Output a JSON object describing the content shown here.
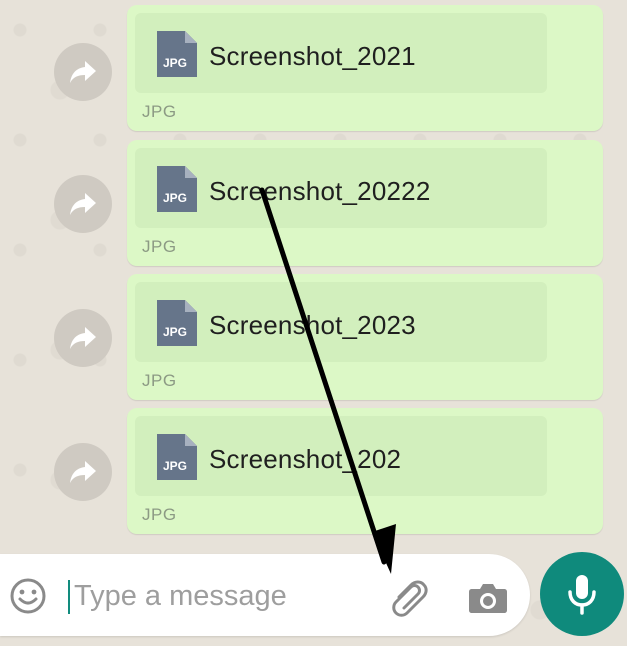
{
  "messages": [
    {
      "file_name": "Screenshot_2021",
      "file_type": "JPG",
      "icon_label": "JPG"
    },
    {
      "file_name": "Screenshot_20222",
      "file_type": "JPG",
      "icon_label": "JPG"
    },
    {
      "file_name": "Screenshot_2023",
      "file_type": "JPG",
      "icon_label": "JPG"
    },
    {
      "file_name": "Screenshot_202",
      "file_type": "JPG",
      "icon_label": "JPG"
    }
  ],
  "composer": {
    "placeholder": "Type a message",
    "value": ""
  },
  "icons": {
    "forward": "forward-arrow-icon",
    "document": "jpg-document-icon",
    "emoji": "emoji-icon",
    "attach": "paperclip-icon",
    "camera": "camera-icon",
    "mic": "microphone-icon"
  },
  "colors": {
    "bubble": "#dcf8c6",
    "chat_background": "#e7e2d9",
    "accent": "#0f8a7c",
    "forward_button": "#cfcac2",
    "document_icon": "#66758a",
    "annotation_arrow": "#000000"
  }
}
